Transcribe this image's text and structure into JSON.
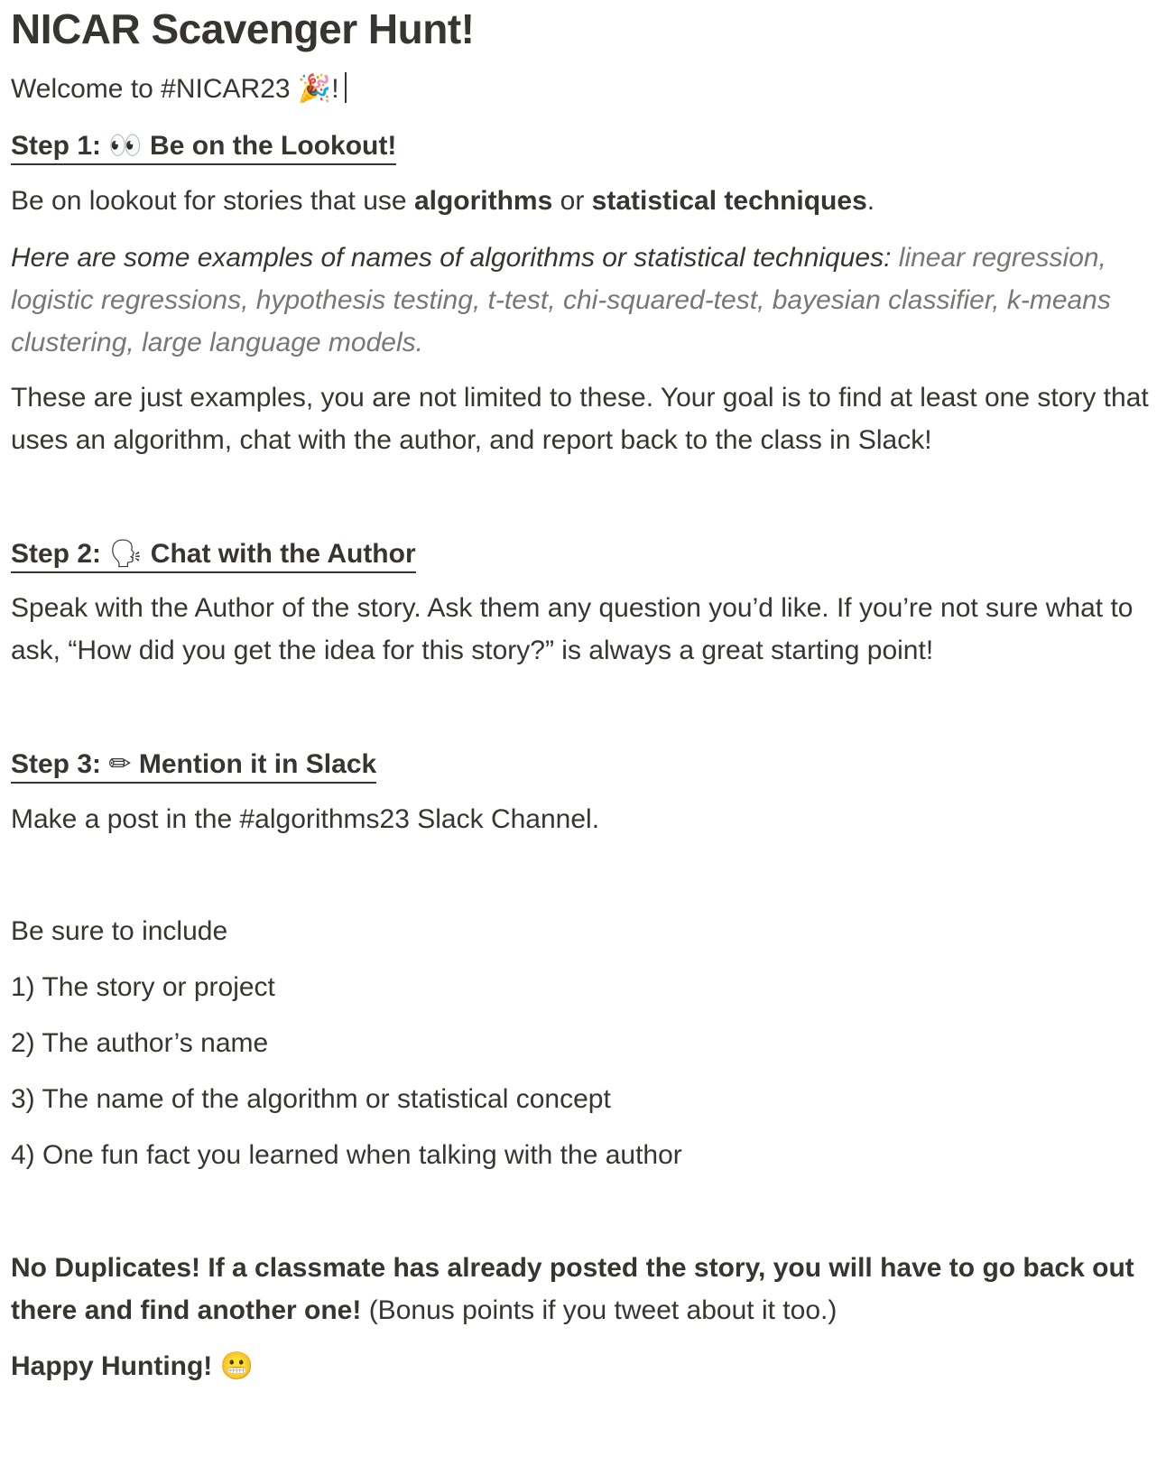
{
  "title": "NICAR Scavenger Hunt!",
  "welcome": {
    "text": "Welcome to #NICAR23 ",
    "emoji": "🎉",
    "suffix": "!"
  },
  "step1": {
    "label": "Step 1: ",
    "emoji": "👀",
    "heading": " Be on the Lookout! ",
    "p1": {
      "a": "Be on lookout for stories that use ",
      "b": "algorithms",
      "c": " or ",
      "d": "statistical techniques",
      "e": "."
    },
    "examples_intro": "Here are some examples of names of algorithms or statistical techniques: ",
    "examples_list": "linear regression, logistic regressions, hypothesis testing, t-test, chi-squared-test, bayesian classifier, k-means clustering, large language models.",
    "p3": "These are just examples, you are not limited to these. Your goal is to find at least one story that uses an algorithm, chat with the author, and report back to the class in Slack!"
  },
  "step2": {
    "label": "Step 2: ",
    "emoji": "🗣",
    "heading": " Chat with the Author",
    "p1": "Speak with the Author of the story. Ask them any question you’d like. If you’re not sure what to ask, “How did you get the idea for this story?” is always a great starting point!"
  },
  "step3": {
    "label": "Step 3: ",
    "emoji": "✏",
    "heading": " Mention it in Slack",
    "p1": "Make a post in the #algorithms23 Slack Channel.",
    "include_intro": "Be sure to include",
    "items": [
      "1) The story or project",
      "2) The author’s name",
      "3) The name of the algorithm or statistical concept",
      "4) One fun fact you learned when talking with the author"
    ]
  },
  "note": {
    "bold": "No Duplicates! If a classmate has already posted the story, you will have to go back out there and find another one!",
    "normal": " (Bonus points if you tweet about it too.)"
  },
  "closing": {
    "text": "Happy Hunting! ",
    "emoji": "😬"
  }
}
